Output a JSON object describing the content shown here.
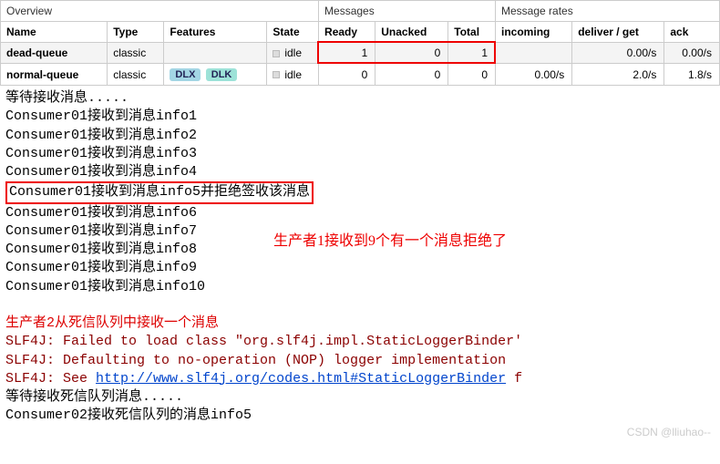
{
  "table": {
    "sections": {
      "overview": "Overview",
      "messages": "Messages",
      "rates": "Message rates"
    },
    "cols": {
      "name": "Name",
      "type": "Type",
      "features": "Features",
      "state": "State",
      "ready": "Ready",
      "unacked": "Unacked",
      "total": "Total",
      "incoming": "incoming",
      "deliver": "deliver / get",
      "ack": "ack"
    },
    "rows": [
      {
        "name": "dead-queue",
        "type": "classic",
        "features": [],
        "state": "idle",
        "ready": "1",
        "unacked": "0",
        "total": "1",
        "incoming": "",
        "deliver": "0.00/s",
        "ack": "0.00/s"
      },
      {
        "name": "normal-queue",
        "type": "classic",
        "features": [
          "DLX",
          "DLK"
        ],
        "state": "idle",
        "ready": "0",
        "unacked": "0",
        "total": "0",
        "incoming": "0.00/s",
        "deliver": "2.0/s",
        "ack": "1.8/s"
      }
    ]
  },
  "console": {
    "wait": "等待接收消息.....",
    "l1": "Consumer01接收到消息info1",
    "l2": "Consumer01接收到消息info2",
    "l3": "Consumer01接收到消息info3",
    "l4": "Consumer01接收到消息info4",
    "l5": "Consumer01接收到消息info5并拒绝签收该消息",
    "l6": "Consumer01接收到消息info6",
    "l7": "Consumer01接收到消息info7",
    "l8": "Consumer01接收到消息info8",
    "l9": "Consumer01接收到消息info9",
    "l10": "Consumer01接收到消息info10",
    "annot1": "生产者1接收到9个有一个消息拒绝了",
    "blank": "",
    "prod2": "生产者2从死信队列中接收一个消息",
    "slf1": "SLF4J: Failed to load class \"org.slf4j.impl.StaticLoggerBinder'",
    "slf2": "SLF4J: Defaulting to no-operation (NOP) logger implementation",
    "slf3a": "SLF4J: See ",
    "slf3link": "http://www.slf4j.org/codes.html#StaticLoggerBinder",
    "slf3b": " f",
    "waitDead": "等待接收死信队列消息.....",
    "c2": "Consumer02接收死信队列的消息info5"
  },
  "watermark": "CSDN @lliuhao--"
}
